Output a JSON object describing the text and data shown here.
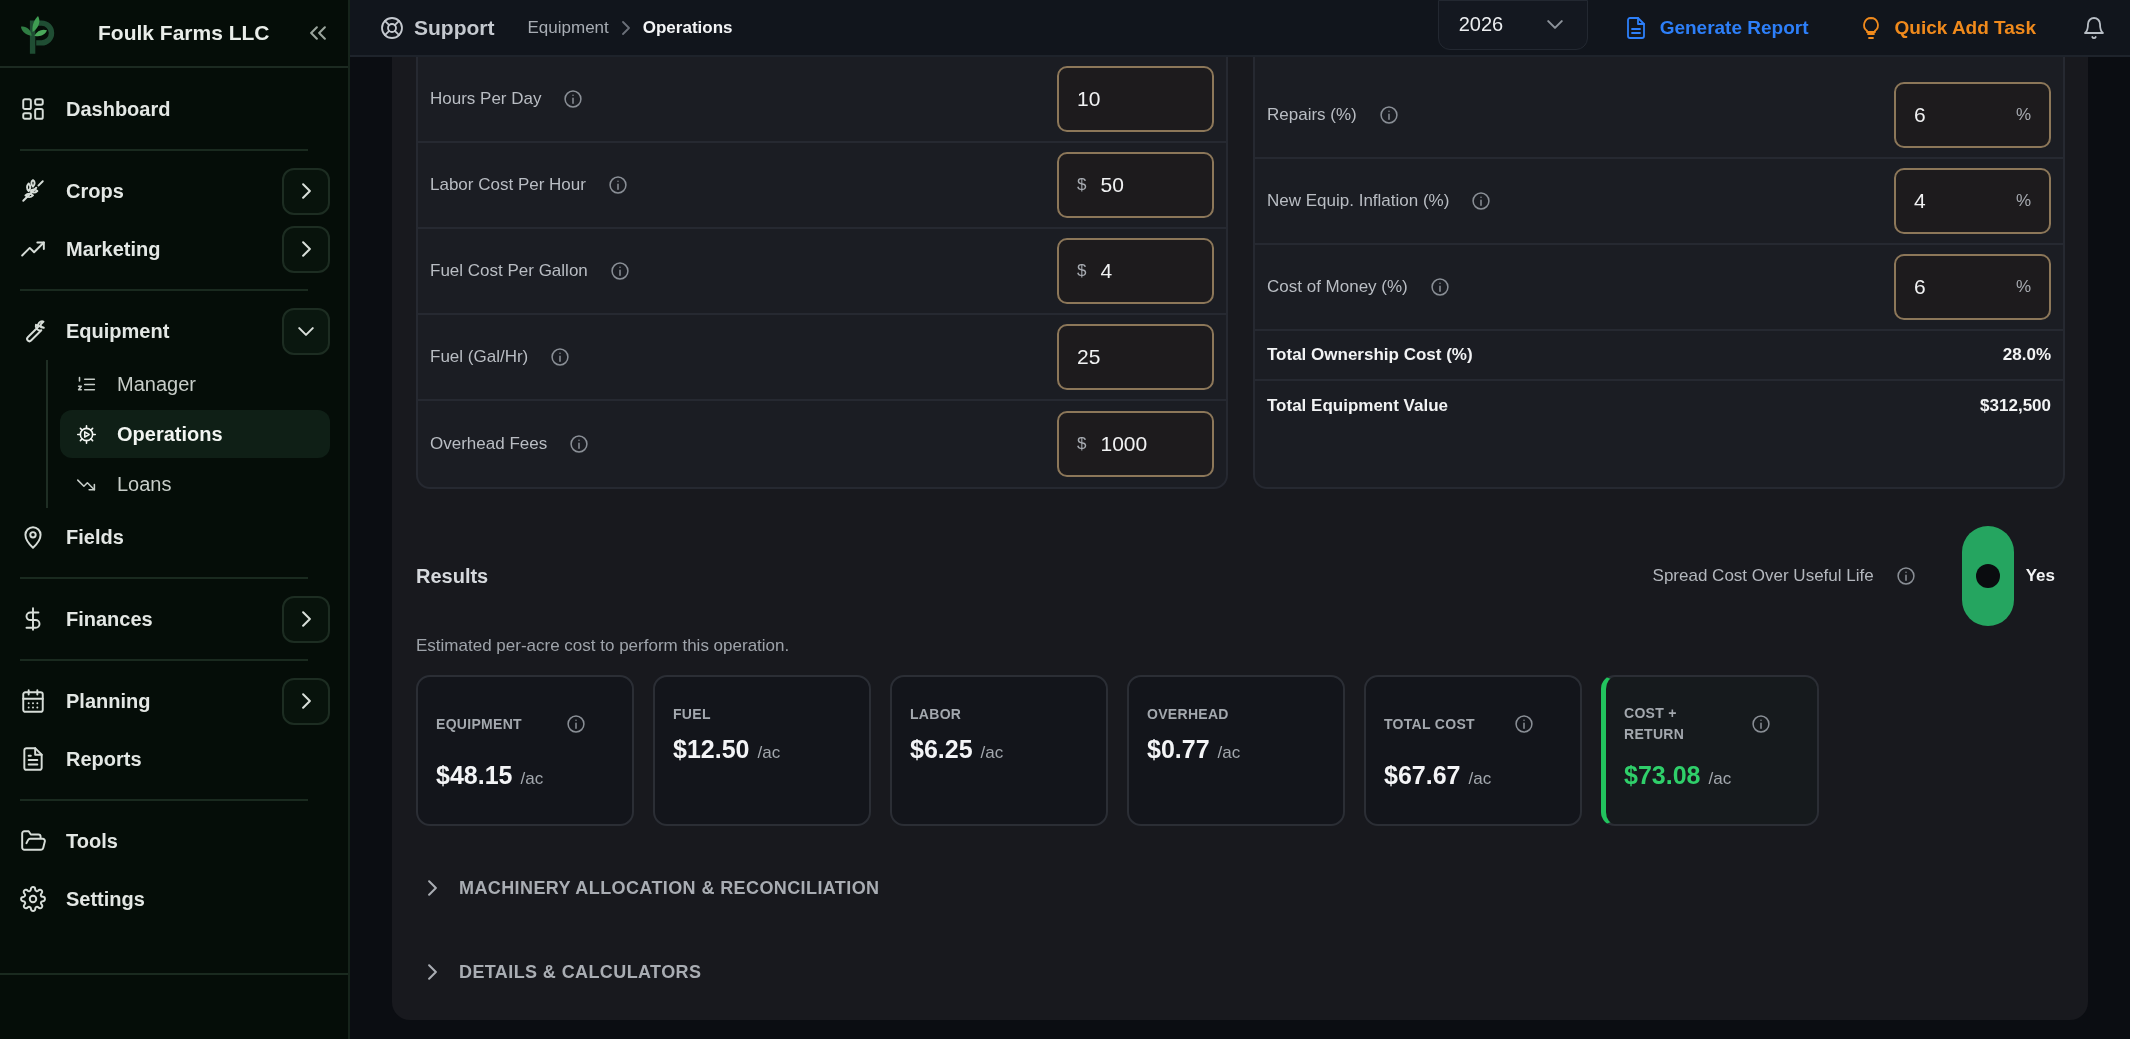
{
  "sidebar": {
    "brand": "Foulk Farms LLC",
    "sections": [
      [
        {
          "label": "Dashboard"
        }
      ],
      [
        {
          "label": "Crops",
          "expanded": false
        },
        {
          "label": "Marketing",
          "expanded": false
        }
      ],
      [
        {
          "label": "Equipment",
          "expanded": true,
          "children": [
            {
              "label": "Manager",
              "selected": false
            },
            {
              "label": "Operations",
              "selected": true
            },
            {
              "label": "Loans",
              "selected": false
            }
          ]
        },
        {
          "label": "Fields"
        }
      ],
      [
        {
          "label": "Finances",
          "expanded": false
        }
      ],
      [
        {
          "label": "Planning",
          "expanded": false
        },
        {
          "label": "Reports"
        }
      ],
      [
        {
          "label": "Tools"
        },
        {
          "label": "Settings"
        }
      ]
    ]
  },
  "topbar": {
    "support": "Support",
    "breadcrumb": [
      "Equipment",
      "Operations"
    ],
    "year": "2026",
    "generate_report": "Generate Report",
    "quick_add": "Quick Add Task"
  },
  "operating_inputs": [
    {
      "label": "Hours Per Day",
      "value": "10"
    },
    {
      "label": "Labor Cost Per Hour",
      "prefix": "$",
      "value": "50"
    },
    {
      "label": "Fuel Cost Per Gallon",
      "prefix": "$",
      "value": "4"
    },
    {
      "label": "Fuel (Gal/Hr)",
      "value": "25"
    },
    {
      "label": "Overhead Fees",
      "prefix": "$",
      "value": "1000"
    }
  ],
  "ownership_inputs": [
    {
      "label": "Repairs (%)",
      "value": "6",
      "suffix": "%"
    },
    {
      "label": "New Equip. Inflation (%)",
      "value": "4",
      "suffix": "%"
    },
    {
      "label": "Cost of Money (%)",
      "value": "6",
      "suffix": "%"
    }
  ],
  "ownership_totals": [
    {
      "label": "Total Ownership Cost (%)",
      "value": "28.0%"
    },
    {
      "label": "Total Equipment Value",
      "value": "$312,500"
    }
  ],
  "results": {
    "title": "Results",
    "toggle": {
      "label": "Spread Cost Over Useful Life",
      "on": true,
      "text": "Yes"
    },
    "description": "Estimated per-acre cost to perform this operation.",
    "cards": [
      {
        "label": "EQUIPMENT",
        "value": "$48.15",
        "unit": "/ac",
        "info": true,
        "highlight": false
      },
      {
        "label": "FUEL",
        "value": "$12.50",
        "unit": "/ac",
        "info": false,
        "highlight": false
      },
      {
        "label": "LABOR",
        "value": "$6.25",
        "unit": "/ac",
        "info": false,
        "highlight": false
      },
      {
        "label": "OVERHEAD",
        "value": "$0.77",
        "unit": "/ac",
        "info": false,
        "highlight": false
      },
      {
        "label": "TOTAL COST",
        "value": "$67.67",
        "unit": "/ac",
        "info": true,
        "highlight": false
      },
      {
        "label": "COST + RETURN",
        "value": "$73.08",
        "unit": "/ac",
        "info": true,
        "highlight": true
      }
    ]
  },
  "sections": [
    {
      "title": "MACHINERY ALLOCATION & RECONCILIATION",
      "expanded": false
    },
    {
      "title": "DETAILS & CALCULATORS",
      "expanded": false
    }
  ]
}
